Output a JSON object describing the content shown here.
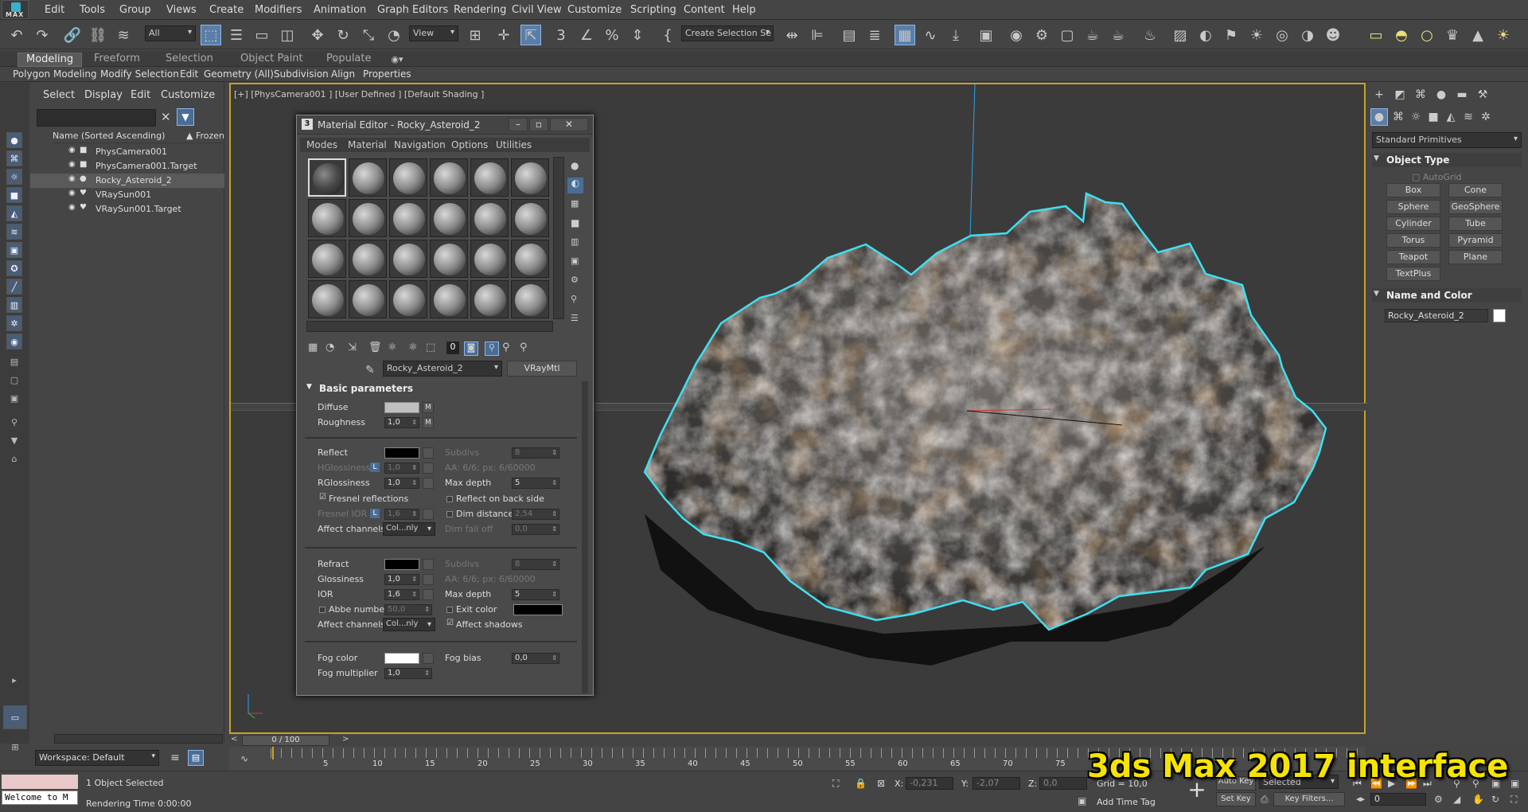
{
  "menubar": {
    "logo_text": "MAX",
    "items": [
      "Edit",
      "Tools",
      "Group",
      "Views",
      "Create",
      "Modifiers",
      "Animation",
      "Graph Editors",
      "Rendering",
      "Civil View",
      "Customize",
      "Scripting",
      "Content",
      "Help"
    ]
  },
  "toolbar": {
    "filter_value": "All",
    "view_value": "View",
    "selection_set": "Create Selection Se"
  },
  "ribbon": {
    "tabs": [
      "Modeling",
      "Freeform",
      "Selection",
      "Object Paint",
      "Populate"
    ],
    "subtabs": [
      "Polygon Modeling",
      "Modify Selection",
      "Edit",
      "Geometry (All)",
      "Subdivision",
      "Align",
      "Properties"
    ]
  },
  "explorer": {
    "menu": [
      "Select",
      "Display",
      "Edit",
      "Customize"
    ],
    "col_name": "Name (Sorted Ascending)",
    "col_frozen": "▲ Frozen",
    "rows": [
      {
        "name": "PhysCamera001",
        "icon": "camera-icon",
        "selected": false
      },
      {
        "name": "PhysCamera001.Target",
        "icon": "camera-icon",
        "selected": false
      },
      {
        "name": "Rocky_Asteroid_2",
        "icon": "sphere-icon",
        "selected": true
      },
      {
        "name": "VRaySun001",
        "icon": "light-icon",
        "selected": false
      },
      {
        "name": "VRaySun001.Target",
        "icon": "light-icon",
        "selected": false
      }
    ],
    "workspace": "Workspace: Default"
  },
  "viewport": {
    "label": "[+] [PhysCamera001 ] [User Defined ] [Default Shading ]"
  },
  "command_panel": {
    "dropdown": "Standard Primitives",
    "object_type_title": "Object Type",
    "autogrid": "AutoGrid",
    "buttons": [
      "Box",
      "Cone",
      "Sphere",
      "GeoSphere",
      "Cylinder",
      "Tube",
      "Torus",
      "Pyramid",
      "Teapot",
      "Plane",
      "TextPlus"
    ],
    "name_color_title": "Name and Color",
    "object_name": "Rocky_Asteroid_2"
  },
  "material_editor": {
    "title": "Material Editor - Rocky_Asteroid_2",
    "title_num": "3",
    "menu": [
      "Modes",
      "Material",
      "Navigation",
      "Options",
      "Utilities"
    ],
    "material_name": "Rocky_Asteroid_2",
    "material_type": "VRayMtl",
    "rollout": "Basic parameters",
    "diffuse": "Diffuse",
    "m": "M",
    "roughness": "Roughness",
    "roughness_val": "1,0",
    "reflect": "Reflect",
    "subdivs": "Subdivs",
    "subdivs_val": "8",
    "hglossiness": "HGlossiness",
    "hgloss_val": "1,0",
    "lock": "L",
    "aa_reflect": "AA: 6/6; px: 6/60000",
    "rglossiness": "RGlossiness",
    "rgloss_val": "1,0",
    "max_depth": "Max depth",
    "max_depth_val": "5",
    "fresnel": "Fresnel reflections",
    "reflect_back": "Reflect on back side",
    "fresnel_ior": "Fresnel IOR",
    "fresnel_ior_val": "1,6",
    "dim_distance": "Dim distance",
    "dim_distance_val": "2,54",
    "affect_channels": "Affect channels",
    "channels_val": "Col...nly",
    "dim_fall_off": "Dim fall off",
    "dim_fall_val": "0,0",
    "refract": "Refract",
    "aa_refract": "AA: 6/6; px: 6/60000",
    "glossiness": "Glossiness",
    "gloss_val": "1,0",
    "ior": "IOR",
    "ior_val": "1,6",
    "abbe": "Abbe number",
    "abbe_val": "50,0",
    "exit_color": "Exit color",
    "affect_shadows": "Affect shadows",
    "fog_color": "Fog color",
    "fog_bias": "Fog bias",
    "fog_bias_val": "0,0",
    "fog_multiplier": "Fog multiplier",
    "fog_mult_val": "1,0"
  },
  "timeline": {
    "frame": "0 / 100",
    "ticks": [
      "5",
      "10",
      "15",
      "20",
      "25",
      "30",
      "35",
      "40",
      "45",
      "50",
      "55",
      "60",
      "65",
      "70",
      "75"
    ]
  },
  "status": {
    "listener": "Welcome to M",
    "selected": "1 Object Selected",
    "render_time": "Rendering Time  0:00:00",
    "x_label": "X:",
    "x_val": "-0,231",
    "y_label": "Y:",
    "y_val": "-2,07",
    "z_label": "Z:",
    "z_val": "0,0",
    "grid": "Grid = 10,0",
    "add_time_tag": "Add Time Tag",
    "auto_key": "Auto Key",
    "selected_dd": "Selected",
    "set_key": "Set Key",
    "key_filters": "Key Filters...",
    "frame_val": "0"
  },
  "overlay": {
    "caption": "3ds Max 2017 interface"
  },
  "colors": {
    "selection_outline": "#3ee0f0",
    "viewport_border": "#c9a227",
    "caption": "#f5e400"
  }
}
